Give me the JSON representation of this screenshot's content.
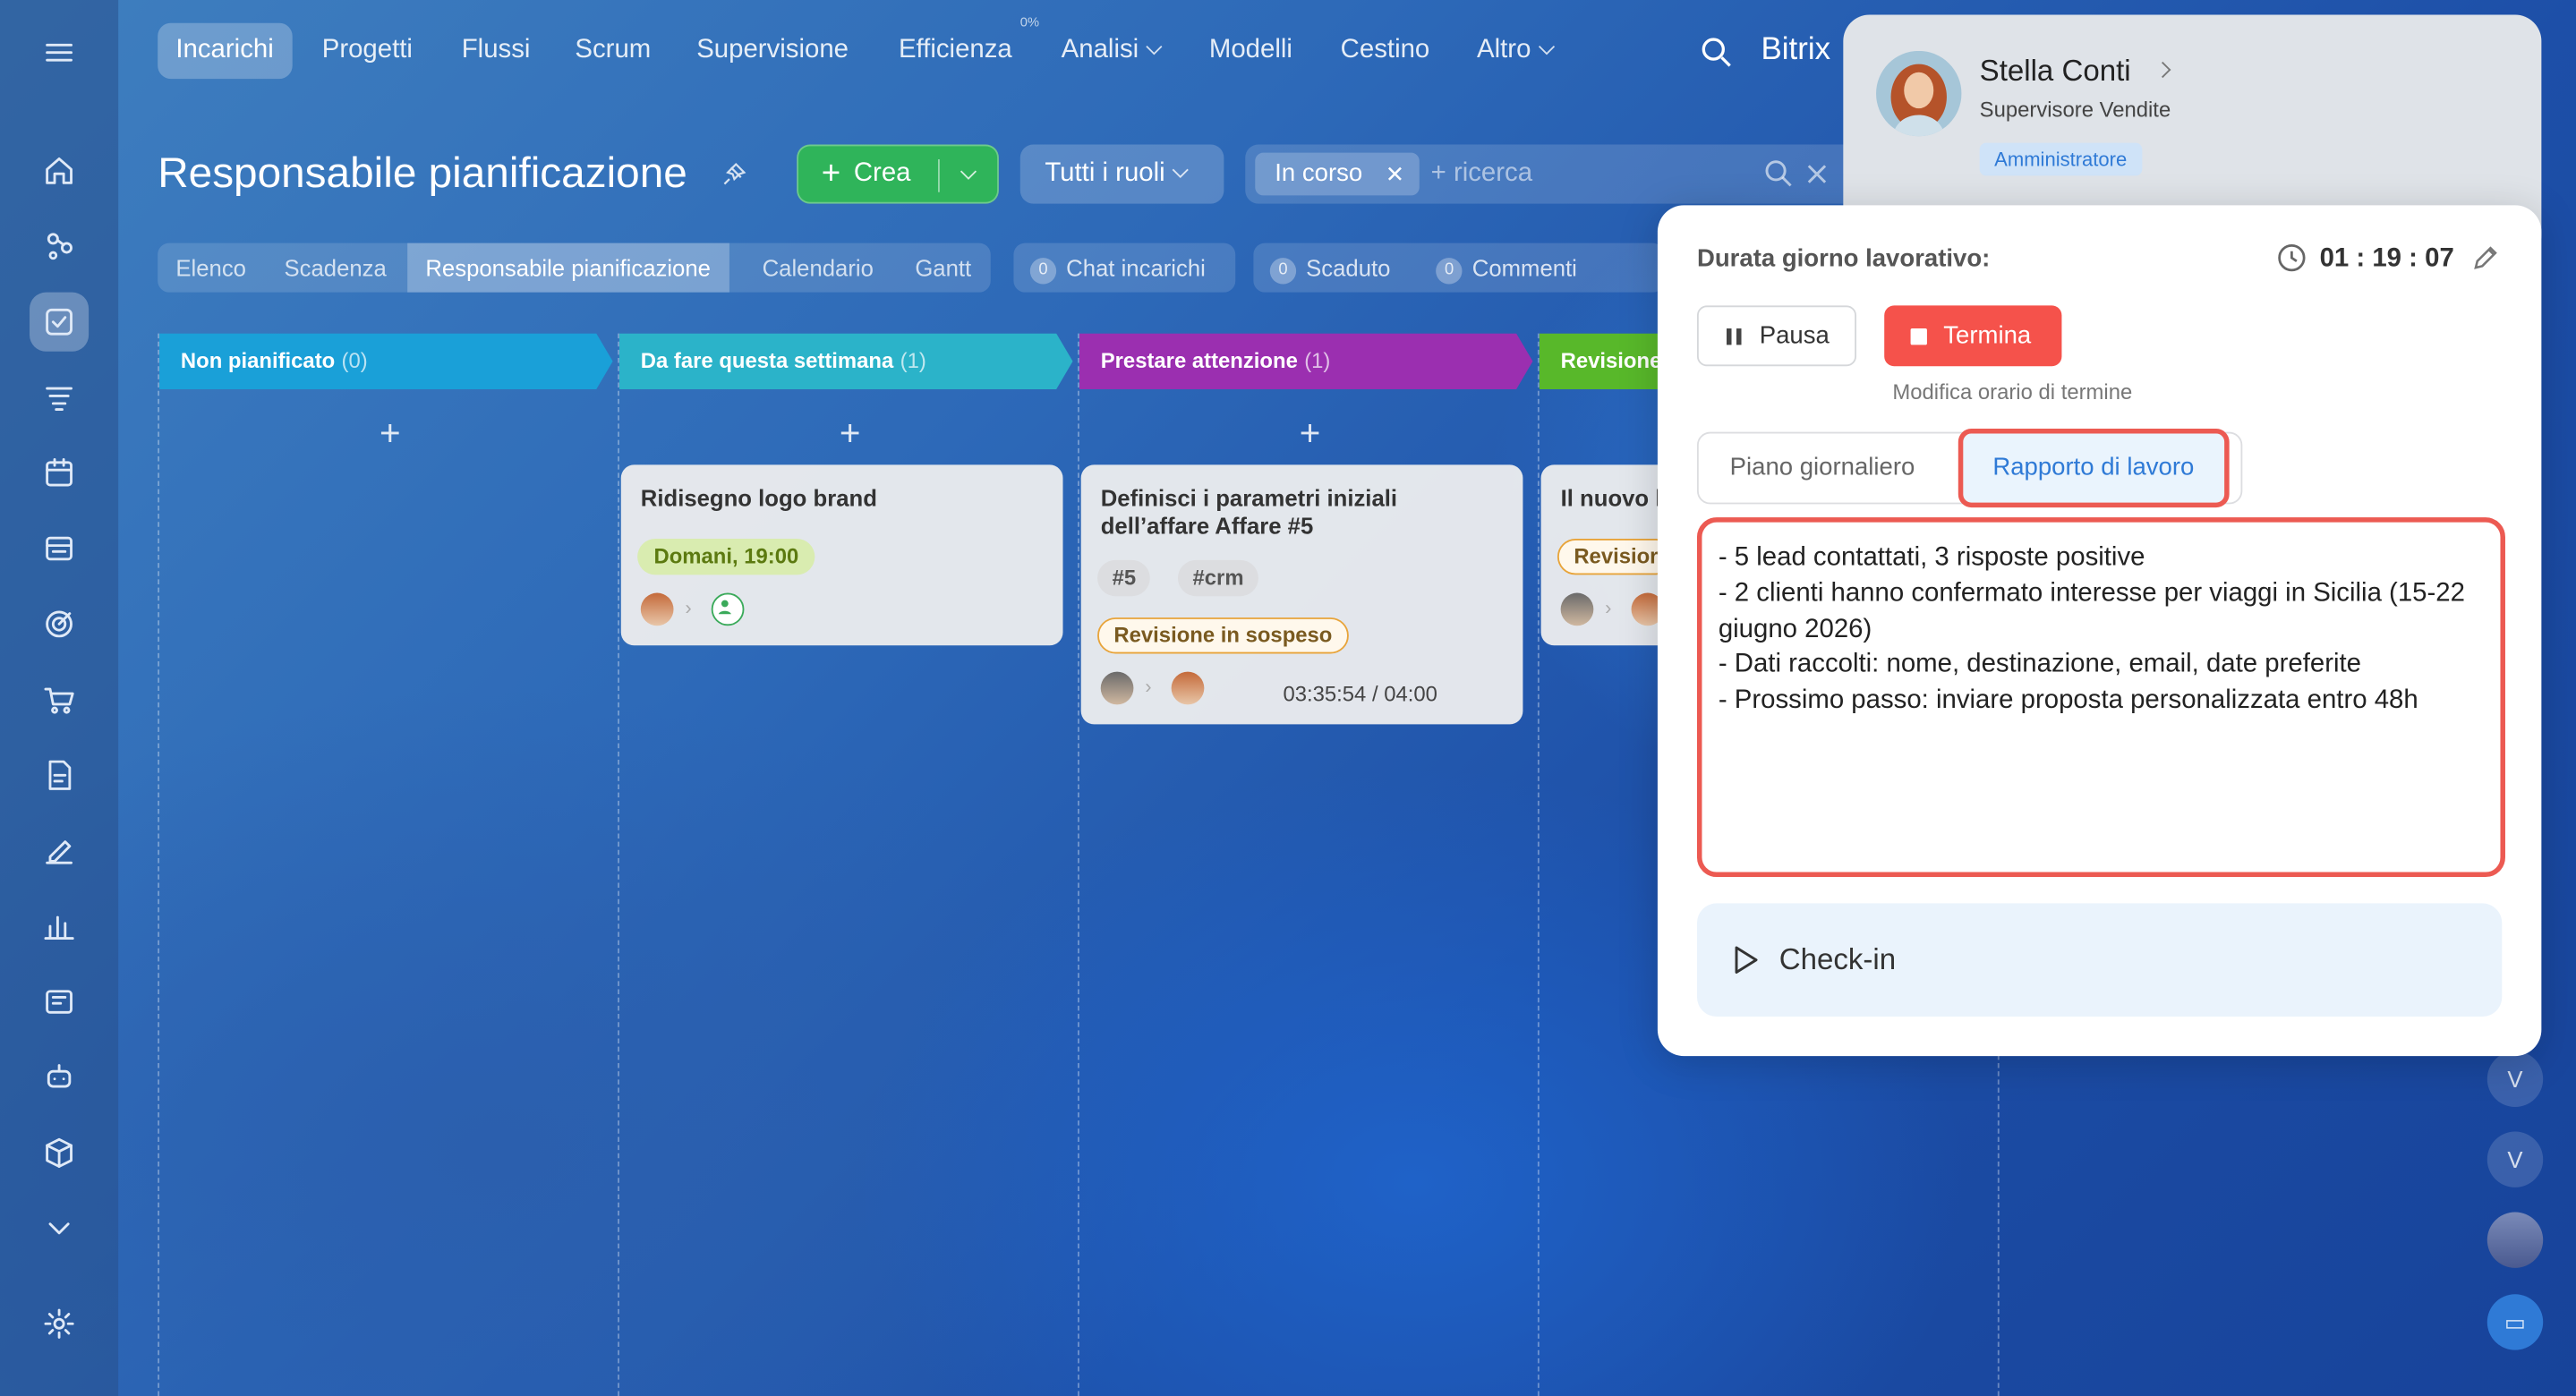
{
  "topnav": {
    "items": [
      "Incarichi",
      "Progetti",
      "Flussi",
      "Scrum",
      "Supervisione",
      "Efficienza",
      "Analisi",
      "Modelli",
      "Cestino",
      "Altro"
    ],
    "efficiency_pct": "0%",
    "brand": "Bitrix"
  },
  "page": {
    "title": "Responsabile pianificazione"
  },
  "toolbar": {
    "create_label": "Crea",
    "roles_label": "Tutti i ruoli",
    "filter_chip": "In corso",
    "search_placeholder": "+ ricerca"
  },
  "subtabs": [
    "Elenco",
    "Scadenza",
    "Responsabile pianificazione",
    "Calendario",
    "Gantt"
  ],
  "counters": {
    "chat": {
      "count": "0",
      "label": "Chat incarichi"
    },
    "overdue": {
      "count": "0",
      "label": "Scaduto"
    },
    "comments": {
      "count": "0",
      "label": "Commenti"
    }
  },
  "columns": [
    {
      "title": "Non pianificato",
      "count": "(0)",
      "color": "#1aa0d8"
    },
    {
      "title": "Da fare questa settimana",
      "count": "(1)",
      "color": "#2bb3c9"
    },
    {
      "title": "Prestare attenzione",
      "count": "(1)",
      "color": "#9b2fb0"
    },
    {
      "title": "Revisione",
      "count": "",
      "color": "#58b82a"
    }
  ],
  "cards": {
    "c1": {
      "title": "Ridisegno logo brand",
      "date": "Domani, 19:00"
    },
    "c2": {
      "title_line1": "Definisci i parametri iniziali",
      "title_line2": "dell’affare Affare #5",
      "tag1": "#5",
      "tag2": "#crm",
      "status": "Revisione in sospeso",
      "timer": "03:35:54 / 04:00"
    },
    "c3": {
      "title": "Il nuovo l",
      "status": "Revisior"
    }
  },
  "profile": {
    "name": "Stella Conti",
    "role": "Supervisore Vendite",
    "badge": "Amministratore"
  },
  "workday": {
    "duration_label": "Durata giorno lavorativo:",
    "time": "01 : 19 : 07",
    "pause_label": "Pausa",
    "end_label": "Termina",
    "modify_link": "Modifica orario di termine",
    "tab_plan": "Piano giornaliero",
    "tab_report": "Rapporto di lavoro",
    "report_text": "- 5 lead contattati, 3 risposte positive\n- 2 clienti hanno confermato interesse per viaggi in Sicilia (15-22 giugno 2026)\n- Dati raccolti: nome, destinazione, email, date preferite\n- Prossimo passo: inviare proposta personalizzata entro 48h",
    "checkin_label": "Check-in"
  },
  "right_rail": {
    "initials": [
      "V",
      "V"
    ]
  },
  "colors": {
    "accent": "#2f7ad6",
    "create_green": "#2fb45a",
    "stop_red": "#f5524b",
    "highlight": "#ec5a52"
  }
}
